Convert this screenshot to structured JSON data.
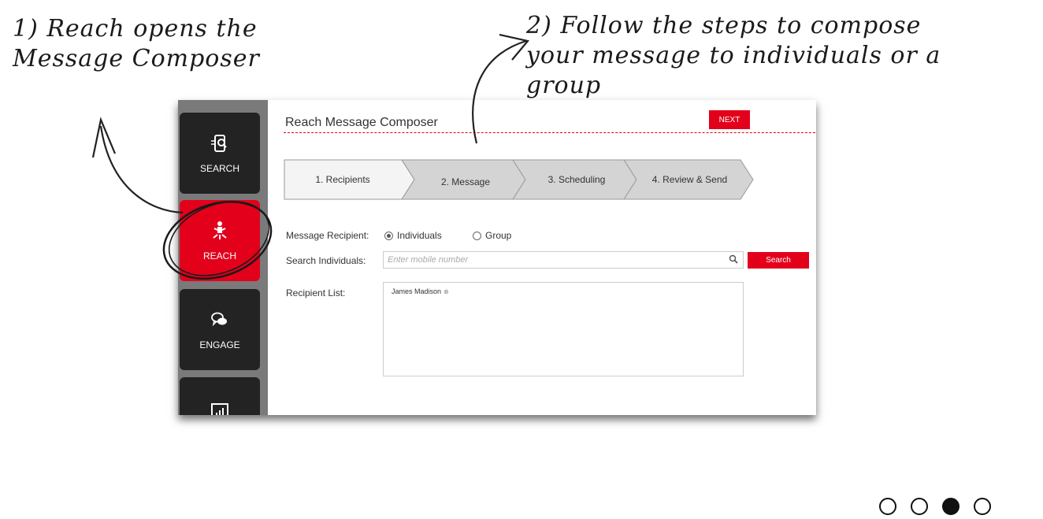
{
  "annotations": {
    "note1": "1) Reach opens the\nMessage Composer",
    "note2": "2) Follow the steps to compose\nyour message to individuals or a\ngroup"
  },
  "sidebar": {
    "items": [
      {
        "label": "SEARCH",
        "icon": "search-phone-icon"
      },
      {
        "label": "REACH",
        "icon": "reach-person-icon",
        "active": true
      },
      {
        "label": "ENGAGE",
        "icon": "chat-bubbles-icon"
      },
      {
        "label": "",
        "icon": "bar-chart-icon"
      }
    ]
  },
  "composer": {
    "title": "Reach Message Composer",
    "next_label": "NEXT",
    "steps": [
      "1. Recipients",
      "2. Message",
      "3. Scheduling",
      "4. Review & Send"
    ],
    "active_step": 0,
    "message_recipient_label": "Message Recipient:",
    "radio_individuals": "Individuals",
    "radio_group": "Group",
    "selected_recipient_type": "Individuals",
    "search_individuals_label": "Search Individuals:",
    "search_placeholder": "Enter mobile number",
    "search_button": "Search",
    "recipient_list_label": "Recipient List:",
    "recipients": [
      "James Madison"
    ]
  },
  "pagination": {
    "total": 4,
    "current": 3
  },
  "colors": {
    "accent": "#e3001b",
    "sidebar_tile": "#232323",
    "sidebar_bg": "#7a7a7a"
  }
}
